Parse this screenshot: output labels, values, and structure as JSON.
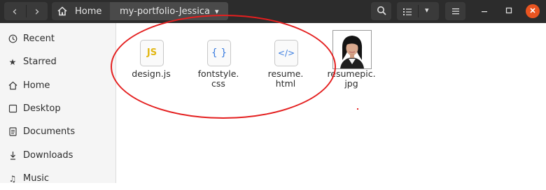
{
  "header": {
    "back_label": "‹",
    "forward_label": "›",
    "path": [
      {
        "label": "Home"
      },
      {
        "label": "my-portfolio-Jessica"
      }
    ],
    "dropdown_glyph": "▾",
    "icons": [
      "chevron-left-icon",
      "chevron-right-icon",
      "home-icon",
      "search-icon",
      "list-view-icon",
      "chevron-down-icon",
      "menu-icon",
      "minimize-icon",
      "maximize-icon",
      "close-icon"
    ]
  },
  "sidebar": {
    "items": [
      {
        "label": "Recent",
        "icon": "clock-icon"
      },
      {
        "label": "Starred",
        "icon": "star-icon"
      },
      {
        "label": "Home",
        "icon": "home-icon"
      },
      {
        "label": "Desktop",
        "icon": "desktop-icon"
      },
      {
        "label": "Documents",
        "icon": "documents-icon"
      },
      {
        "label": "Downloads",
        "icon": "download-icon"
      },
      {
        "label": "Music",
        "icon": "music-icon"
      }
    ]
  },
  "files": [
    {
      "name_line1": "design.js",
      "name_line2": "",
      "icon_text": "JS",
      "icon_color": "#e2b714"
    },
    {
      "name_line1": "fontstyle.",
      "name_line2": "css",
      "icon_text": "{ }",
      "icon_color": "#3b7de0"
    },
    {
      "name_line1": "resume.",
      "name_line2": "html",
      "icon_text": "</>",
      "icon_color": "#3b7de0"
    },
    {
      "name_line1": "resumepic.",
      "name_line2": "jpg",
      "icon_text": "",
      "icon_color": ""
    }
  ],
  "colors": {
    "header_bg": "#2c2c2c",
    "accent_close": "#e95420",
    "annotation": "#e41f1f"
  }
}
